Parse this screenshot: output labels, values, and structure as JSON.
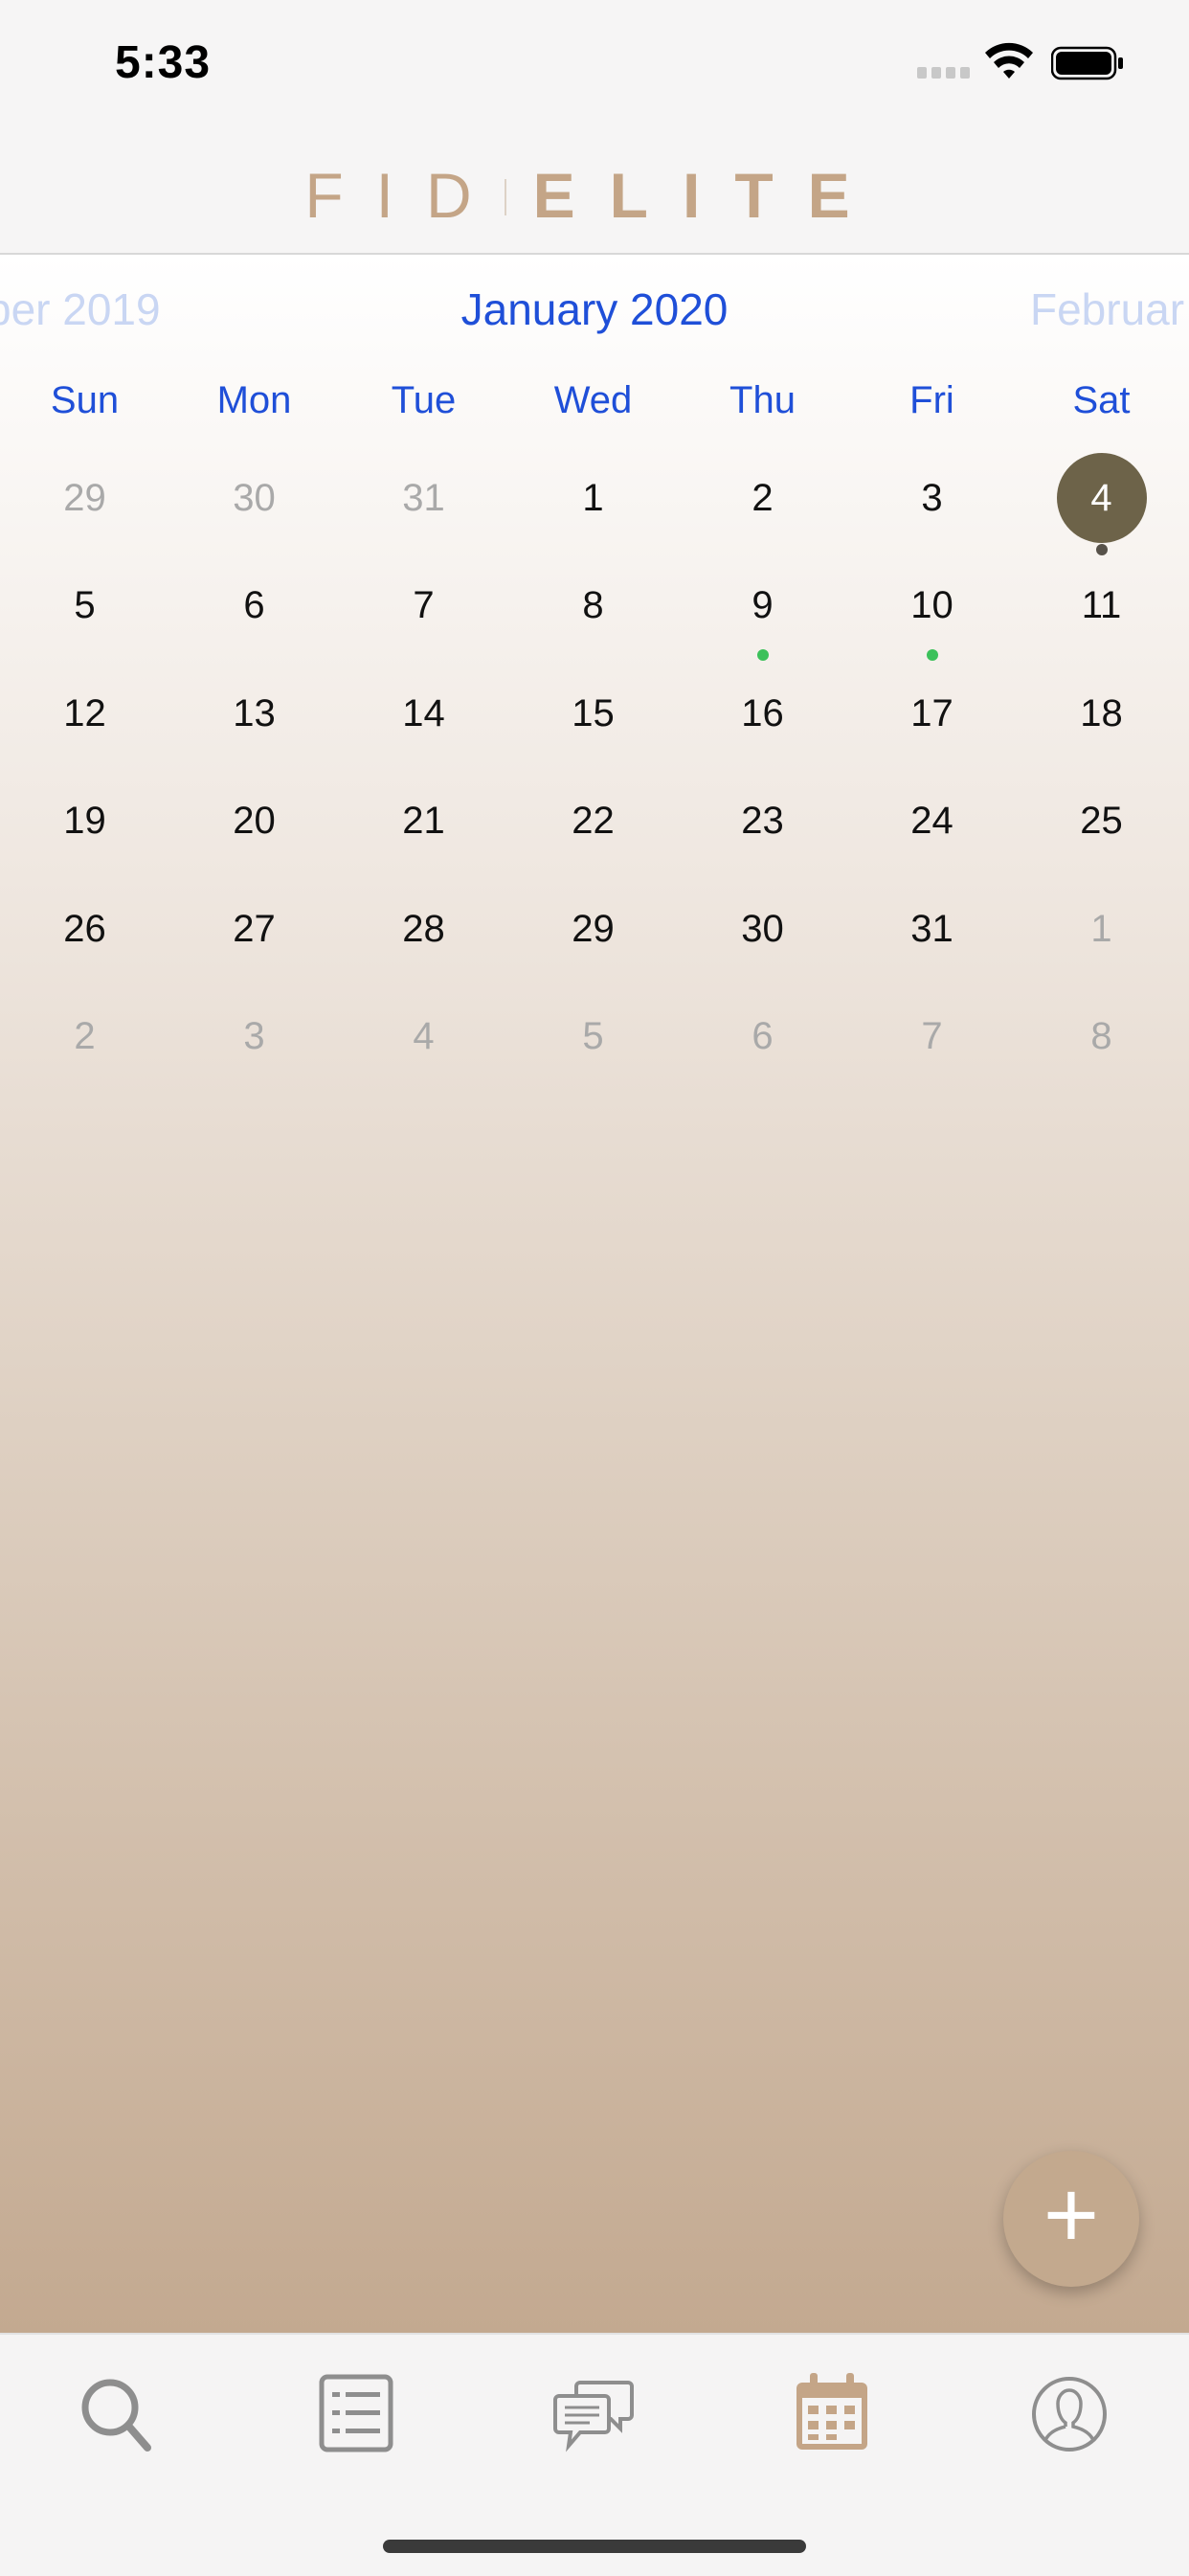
{
  "status": {
    "time": "5:33"
  },
  "brand": {
    "left": "FID",
    "right": "ELITE"
  },
  "calendar": {
    "prev_month": "ber 2019",
    "current_month": "January 2020",
    "next_month": "Februar",
    "weekdays": [
      "Sun",
      "Mon",
      "Tue",
      "Wed",
      "Thu",
      "Fri",
      "Sat"
    ],
    "weeks": [
      [
        "29",
        "30",
        "31",
        "1",
        "2",
        "3",
        "4"
      ],
      [
        "5",
        "6",
        "7",
        "8",
        "9",
        "10",
        "11"
      ],
      [
        "12",
        "13",
        "14",
        "15",
        "16",
        "17",
        "18"
      ],
      [
        "19",
        "20",
        "21",
        "22",
        "23",
        "24",
        "25"
      ],
      [
        "26",
        "27",
        "28",
        "29",
        "30",
        "31",
        "1"
      ],
      [
        "2",
        "3",
        "4",
        "5",
        "6",
        "7",
        "8"
      ]
    ],
    "selected_day": "4",
    "event_days": [
      "9",
      "10"
    ],
    "accent_color": "#1f4fd8",
    "selected_color": "#6d6349",
    "event_dot_color": "#3cc15a"
  },
  "fab": {
    "label": "+"
  },
  "tabs": [
    {
      "icon": "search-icon"
    },
    {
      "icon": "list-icon"
    },
    {
      "icon": "chat-icon"
    },
    {
      "icon": "calendar-icon",
      "active": true
    },
    {
      "icon": "profile-icon"
    }
  ]
}
